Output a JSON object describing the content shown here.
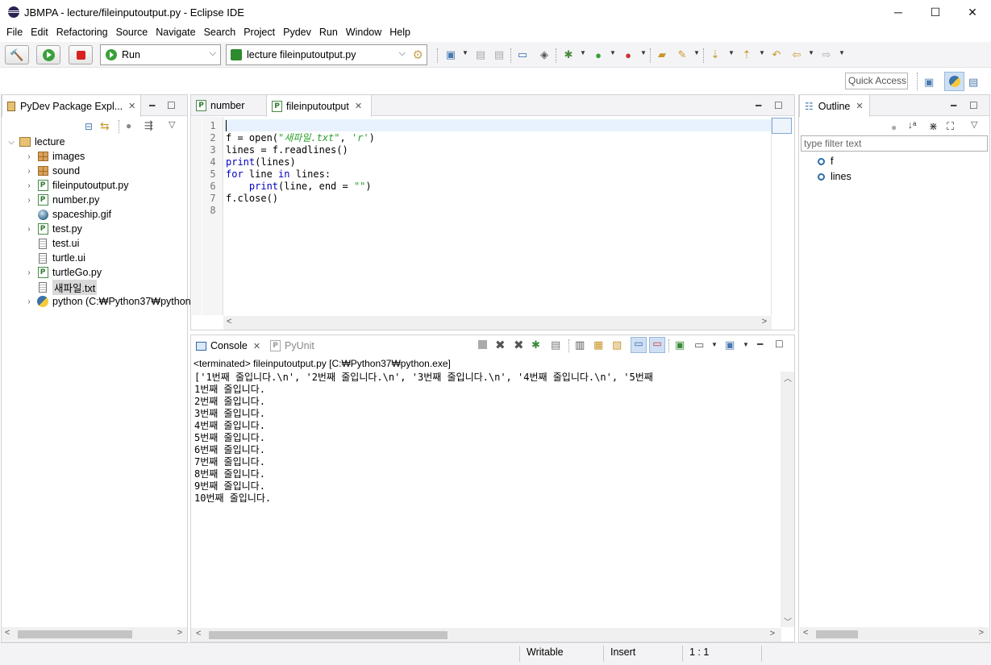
{
  "window": {
    "title": "JBMPA - lecture/fileinputoutput.py - Eclipse IDE",
    "minimize_glyph": "─",
    "maximize_glyph": "☐",
    "close_glyph": "✕"
  },
  "menu": [
    "File",
    "Edit",
    "Refactoring",
    "Source",
    "Navigate",
    "Search",
    "Project",
    "Pydev",
    "Run",
    "Window",
    "Help"
  ],
  "toolbar": {
    "run_combo_value": "Run",
    "launch_combo_value": "lecture fileinputoutput.py",
    "quick_access_placeholder": "Quick Access"
  },
  "explorer": {
    "tab_label": "PyDev Package Expl...",
    "project": "lecture",
    "items": [
      {
        "label": "images",
        "type": "package",
        "expandable": true
      },
      {
        "label": "sound",
        "type": "package",
        "expandable": true
      },
      {
        "label": "fileinputoutput.py",
        "type": "python",
        "expandable": true
      },
      {
        "label": "number.py",
        "type": "python",
        "expandable": true
      },
      {
        "label": "spaceship.gif",
        "type": "image",
        "expandable": false
      },
      {
        "label": "test.py",
        "type": "python",
        "expandable": true
      },
      {
        "label": "test.ui",
        "type": "text",
        "expandable": false
      },
      {
        "label": "turtle.ui",
        "type": "text",
        "expandable": false
      },
      {
        "label": "turtleGo.py",
        "type": "python",
        "expandable": true
      },
      {
        "label": "새파일.txt",
        "type": "text",
        "expandable": false,
        "selected": true
      },
      {
        "label": "python  (C:₩Python37₩python",
        "type": "interpreter",
        "expandable": true
      }
    ]
  },
  "editor": {
    "tabs": [
      {
        "label": "number",
        "active": false
      },
      {
        "label": "fileinputoutput",
        "active": true
      }
    ],
    "line_numbers": [
      "1",
      "2",
      "3",
      "4",
      "5",
      "6",
      "7",
      "8"
    ]
  },
  "outline": {
    "tab_label": "Outline",
    "filter_placeholder": "type filter text",
    "items": [
      "f",
      "lines"
    ]
  },
  "console": {
    "tabs": [
      {
        "label": "Console",
        "active": true
      },
      {
        "label": "PyUnit",
        "active": false
      }
    ],
    "header": "<terminated> fileinputoutput.py [C:₩Python37₩python.exe]",
    "lines": [
      "['1번째 줄입니다.\\n', '2번째 줄입니다.\\n', '3번째 줄입니다.\\n', '4번째 줄입니다.\\n', '5번째",
      "1번째 줄입니다.",
      "2번째 줄입니다.",
      "3번째 줄입니다.",
      "4번째 줄입니다.",
      "5번째 줄입니다.",
      "6번째 줄입니다.",
      "7번째 줄입니다.",
      "8번째 줄입니다.",
      "9번째 줄입니다.",
      "10번째 줄입니다."
    ]
  },
  "status": {
    "writable": "Writable",
    "insert_mode": "Insert",
    "position": "1 : 1"
  }
}
